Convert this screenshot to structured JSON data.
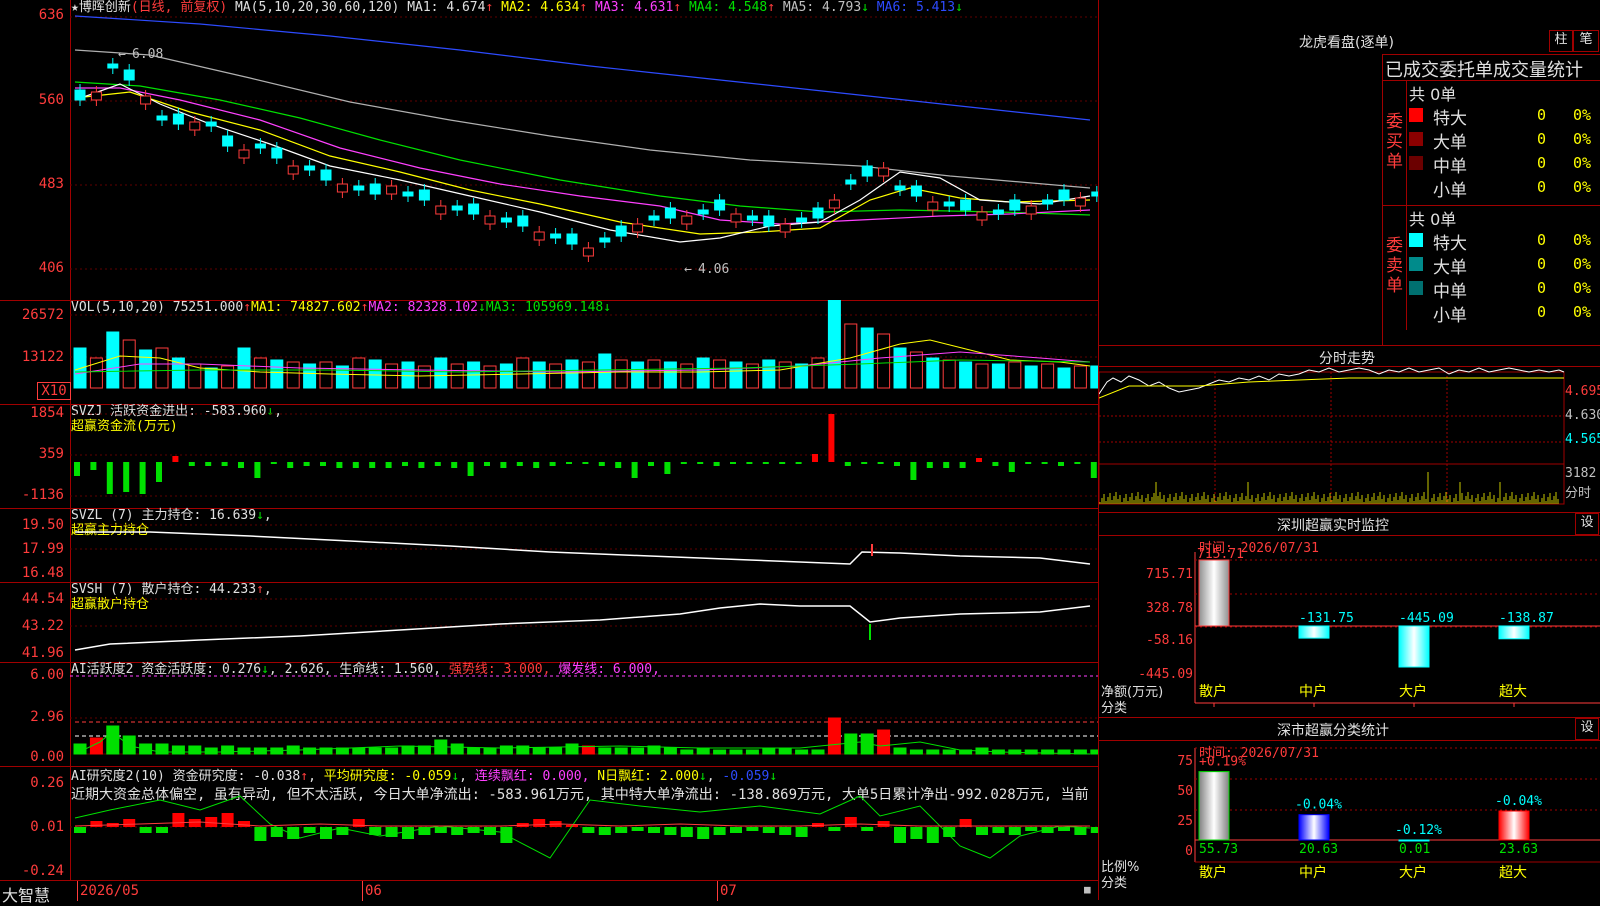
{
  "main": {
    "stock_name": "博晖创新",
    "period": "(日线, 前复权)",
    "ma_label": "MA(5,10,20,30,60,120)",
    "ma": [
      {
        "label": "MA1: 4.674",
        "arrow": "↑",
        "color": "#e0e0e0"
      },
      {
        "label": "MA2: 4.634",
        "arrow": "↑",
        "color": "#ffff00"
      },
      {
        "label": "MA3: 4.631",
        "arrow": "↑",
        "color": "#ff40ff"
      },
      {
        "label": "MA4: 4.548",
        "arrow": "↑",
        "color": "#00e000"
      },
      {
        "label": "MA5: 4.793",
        "arrow": "↓",
        "color": "#c0c0c0"
      },
      {
        "label": "MA6: 5.413",
        "arrow": "↓",
        "color": "#2d4bff"
      }
    ],
    "y_labels": [
      "636",
      "560",
      "483",
      "406"
    ],
    "high_note": "6.08",
    "low_note": "4.06"
  },
  "vol": {
    "header": "VOL(5,10,20)",
    "value": "75251.000",
    "ma1": "MA1: 74827.602",
    "ma2": "MA2: 82328.102",
    "ma3": "MA3: 105969.148",
    "y_labels": [
      "26572",
      "13122"
    ],
    "unit": "X10"
  },
  "svzj": {
    "header": "SVZJ  活跃资金进出: -583.960",
    "subtitle": "超赢资金流(万元)",
    "y_labels": [
      "1854",
      "359",
      "-1136"
    ]
  },
  "svzl": {
    "header": "SVZL (7) 主力持仓: 16.639",
    "subtitle": "超赢主力持仓",
    "y_labels": [
      "19.50",
      "17.99",
      "16.48"
    ]
  },
  "svsh": {
    "header": "SVSH (7) 散户持仓: 44.233",
    "subtitle": "超赢散户持仓",
    "y_labels": [
      "44.54",
      "43.22",
      "41.96"
    ]
  },
  "ai_active": {
    "header": "AI活跃度2 资金活跃度: 0.276",
    "v2": "2.626,",
    "life": "生命线: 1.560,",
    "strong": "强势线: 3.000,",
    "burst": "爆发线: 6.000,",
    "y_labels": [
      "6.00",
      "2.96",
      "0.00"
    ]
  },
  "ai_research": {
    "header": "AI研究度2(10) 资金研究度: -0.038",
    "avg": "平均研究度: -0.059",
    "red_days": "连续飘红: 0.000,",
    "n_red": "N日飘红: 2.000",
    "last": "-0.059",
    "commentary": "近期大资金总体偏空, 虽有异动, 但不太活跃, 今日大单净流出: -583.961万元, 其中特大单净流出: -138.869万元, 大单5日累计净出-992.028万元, 当前",
    "y_labels": [
      "0.26",
      "0.01",
      "-0.24"
    ]
  },
  "footer": {
    "brand": "大智慧",
    "dates": [
      "2026/05",
      "06",
      "07"
    ]
  },
  "dragon": {
    "title": "龙虎看盘(逐单)",
    "btn1": "柱",
    "btn2": "笔",
    "subtitle": "已成交委托单成交量统计",
    "buy_label": "委买单",
    "sell_label": "委卖单",
    "buy_total": "共 0单",
    "sell_total": "共 0单",
    "buy_rows": [
      {
        "name": "特大",
        "count": "0",
        "pct": "0%",
        "color": "#ff0000"
      },
      {
        "name": "大单",
        "count": "0",
        "pct": "0%",
        "color": "#8b0000"
      },
      {
        "name": "中单",
        "count": "0",
        "pct": "0%",
        "color": "#6b0000"
      },
      {
        "name": "小单",
        "count": "0",
        "pct": "0%",
        "color": "#000000"
      }
    ],
    "sell_rows": [
      {
        "name": "特大",
        "count": "0",
        "pct": "0%",
        "color": "#00ffff"
      },
      {
        "name": "大单",
        "count": "0",
        "pct": "0%",
        "color": "#008b8b"
      },
      {
        "name": "中单",
        "count": "0",
        "pct": "0%",
        "color": "#007070"
      },
      {
        "name": "小单",
        "count": "0",
        "pct": "0%",
        "color": "#000000"
      }
    ]
  },
  "intraday": {
    "title": "分时走势",
    "y_labels": [
      "4.695",
      "4.630",
      "4.565"
    ],
    "vol_label": "3182",
    "vol_unit": "分时"
  },
  "sz_monitor": {
    "title": "深圳超赢实时监控",
    "btn": "设",
    "time": "时间: 2026/07/31",
    "y_labels": [
      "715.71",
      "328.78",
      "-58.16",
      "-445.09"
    ],
    "axis_title": "净额(万元)",
    "axis_sub": "分类"
  },
  "sz_stats": {
    "title": "深市超赢分类统计",
    "btn": "设",
    "time": "时间: 2026/07/31",
    "y_labels": [
      "75",
      "50",
      "25",
      "0"
    ],
    "axis_title": "比例%",
    "axis_sub": "分类"
  },
  "chart_data": [
    {
      "type": "bar",
      "title": "深圳超赢实时监控",
      "categories": [
        "散户",
        "中户",
        "大户",
        "超大"
      ],
      "values": [
        715.71,
        -131.75,
        -445.09,
        -138.87
      ],
      "ylim": [
        -445.09,
        715.71
      ]
    },
    {
      "type": "bar",
      "title": "深市超赢分类统计",
      "categories": [
        "散户",
        "中户",
        "大户",
        "超大"
      ],
      "values": [
        55.73,
        20.63,
        0.01,
        23.63
      ],
      "changes": [
        "+0.19%",
        "-0.04%",
        "-0.12%",
        "-0.04%"
      ],
      "colors": [
        "#ffffff",
        "#0000ff",
        "#00ffff",
        "#ff0000"
      ],
      "ylim": [
        0,
        75
      ]
    }
  ]
}
